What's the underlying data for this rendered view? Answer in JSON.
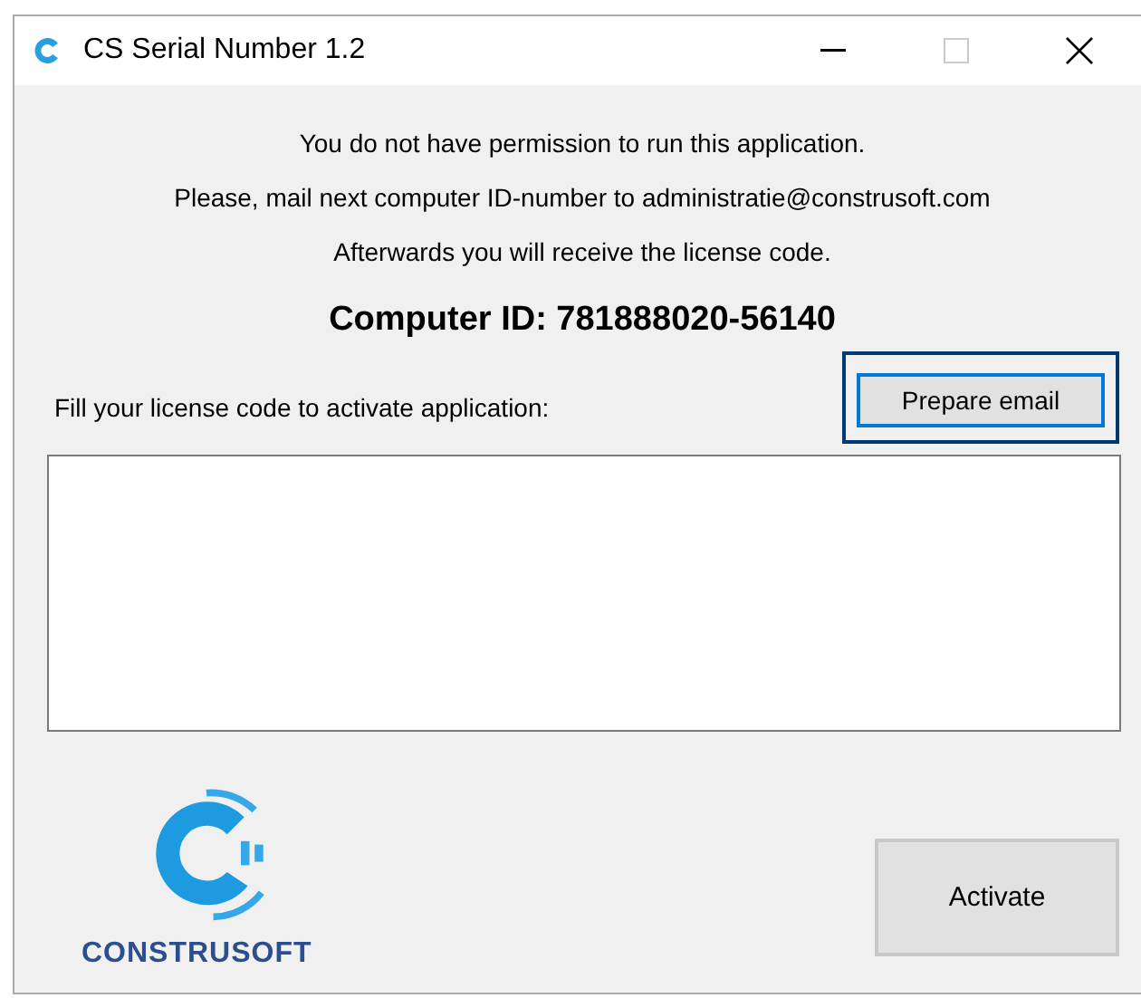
{
  "window": {
    "title": "CS Serial Number 1.2"
  },
  "messages": [
    "You do not have permission to run this application.",
    "Please, mail next computer ID-number to administratie@construsoft.com",
    "Afterwards you will receive the license code."
  ],
  "computer_id": "Computer ID: 781888020-56140",
  "license_label": "Fill your license code to activate application:",
  "prepare_button": {
    "label": "Prepare email",
    "focused": true
  },
  "logo_text": "CONSTRUSOFT",
  "activate_button": {
    "label": "Activate"
  }
}
